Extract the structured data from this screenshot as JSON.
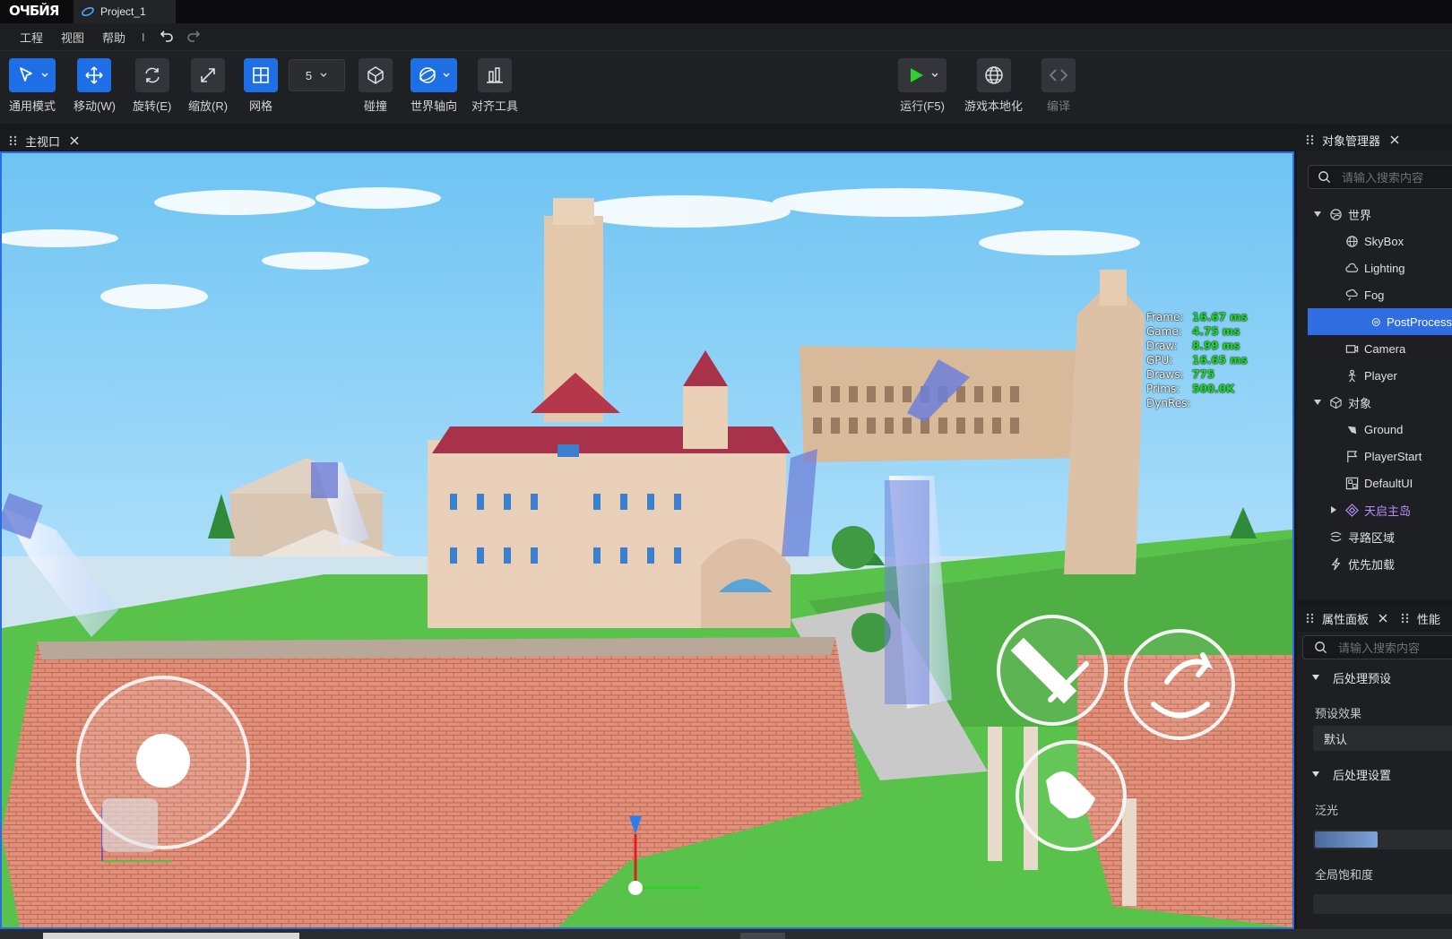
{
  "app": {
    "logo": "ОЧБЙЯ",
    "project_tab": "Project_1"
  },
  "menu": {
    "items": [
      "工程",
      "视图",
      "帮助"
    ],
    "separator": "I"
  },
  "toolbar": {
    "general_mode": "通用模式",
    "move": "移动(W)",
    "rotate": "旋转(E)",
    "scale": "缩放(R)",
    "grid": "网格",
    "grid_size": "5",
    "collision": "碰撞",
    "world_axis": "世界轴向",
    "align": "对齐工具",
    "run": "运行(F5)",
    "localize": "游戏本地化",
    "compile": "编译"
  },
  "viewport": {
    "tab": "主视口",
    "stats": [
      {
        "k": "Frame:",
        "v": "16.67 ms"
      },
      {
        "k": "Game:",
        "v": "4.75 ms"
      },
      {
        "k": "Draw:",
        "v": "8.99 ms"
      },
      {
        "k": "GPU:",
        "v": "16.65 ms"
      },
      {
        "k": "Draws:",
        "v": "775"
      },
      {
        "k": "Prims:",
        "v": "500.0K"
      },
      {
        "k": "DynRes:",
        "v": ""
      }
    ]
  },
  "object_manager": {
    "tab": "对象管理器",
    "search_placeholder": "请输入搜索内容",
    "tree": [
      {
        "label": "世界",
        "icon": "world-icon",
        "depth": 0,
        "expanded": true
      },
      {
        "label": "SkyBox",
        "icon": "globe-icon",
        "depth": 1
      },
      {
        "label": "Lighting",
        "icon": "cloud-icon",
        "depth": 1
      },
      {
        "label": "Fog",
        "icon": "fog-icon",
        "depth": 1
      },
      {
        "label": "PostProcess",
        "icon": "postprocess-icon",
        "depth": 1,
        "selected": true
      },
      {
        "label": "Camera",
        "icon": "camera-icon",
        "depth": 1
      },
      {
        "label": "Player",
        "icon": "player-icon",
        "depth": 1
      },
      {
        "label": "对象",
        "icon": "cube-icon",
        "depth": 0,
        "expanded": true
      },
      {
        "label": "Ground",
        "icon": "ground-icon",
        "depth": 1
      },
      {
        "label": "PlayerStart",
        "icon": "flag-icon",
        "depth": 1
      },
      {
        "label": "DefaultUI",
        "icon": "ui-icon",
        "depth": 1
      },
      {
        "label": "天启主岛",
        "icon": "prefab-icon",
        "depth": 1,
        "collapsed": true,
        "color": "#b58cff"
      },
      {
        "label": "寻路区域",
        "icon": "navmesh-icon",
        "depth": 0
      },
      {
        "label": "优先加载",
        "icon": "priority-icon",
        "depth": 0
      }
    ]
  },
  "properties": {
    "tab": "属性面板",
    "tab2": "性能",
    "search_placeholder": "请输入搜索内容",
    "section1": "后处理预设",
    "preset_label": "预设效果",
    "preset_value": "默认",
    "section2": "后处理设置",
    "bloom_label": "泛光",
    "bloom_level": 0.45,
    "saturation_label": "全局饱和度"
  },
  "colors": {
    "accent": "#1e6fe6",
    "selection": "#2f6de0",
    "stat_value": "#19e019"
  }
}
